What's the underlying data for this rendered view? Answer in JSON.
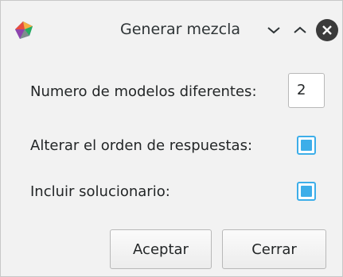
{
  "window": {
    "title": "Generar mezcla",
    "icons": {
      "app": "app-logo-icon",
      "minimize": "chevron-down-icon",
      "maximize": "chevron-up-icon",
      "close": "close-icon"
    }
  },
  "form": {
    "models_label": "Numero de modelos diferentes:",
    "models_value": "2",
    "order_label": "Alterar el orden de respuestas:",
    "order_checked": true,
    "solutions_label": "Incluir solucionario:",
    "solutions_checked": true
  },
  "buttons": {
    "accept_label": "Aceptar",
    "close_label": "Cerrar"
  },
  "colors": {
    "accent": "#3daee9",
    "window_bg": "#f2f2f2",
    "text": "#232627"
  }
}
